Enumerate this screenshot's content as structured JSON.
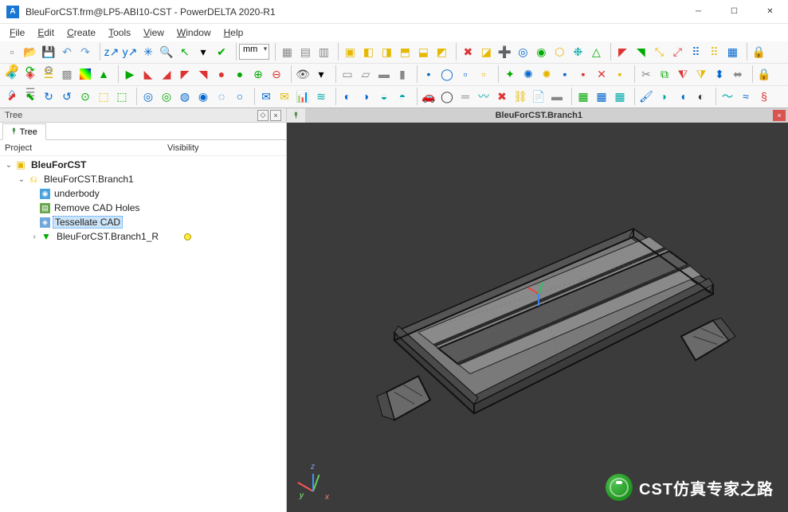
{
  "window": {
    "title": "BleuForCST.frm@LP5-ABI10-CST - PowerDELTA 2020-R1",
    "app_icon_letter": "A"
  },
  "menu": {
    "file": "File",
    "edit": "Edit",
    "create": "Create",
    "tools": "Tools",
    "view": "View",
    "window": "Window",
    "help": "Help"
  },
  "toolbar": {
    "units": "mm"
  },
  "tree_panel": {
    "title": "Tree",
    "tab": "Tree",
    "col_project": "Project",
    "col_visibility": "Visibility",
    "nodes": {
      "root": "BleuForCST",
      "branch": "BleuForCST.Branch1",
      "underbody": "underbody",
      "remove_holes": "Remove CAD Holes",
      "tessellate": "Tessellate CAD",
      "branch_r": "BleuForCST.Branch1_R"
    }
  },
  "viewport": {
    "tab_title": "BleuForCST.Branch1",
    "axes": {
      "x": "x",
      "y": "y",
      "z": "z"
    }
  },
  "watermark": "CST仿真专家之路"
}
